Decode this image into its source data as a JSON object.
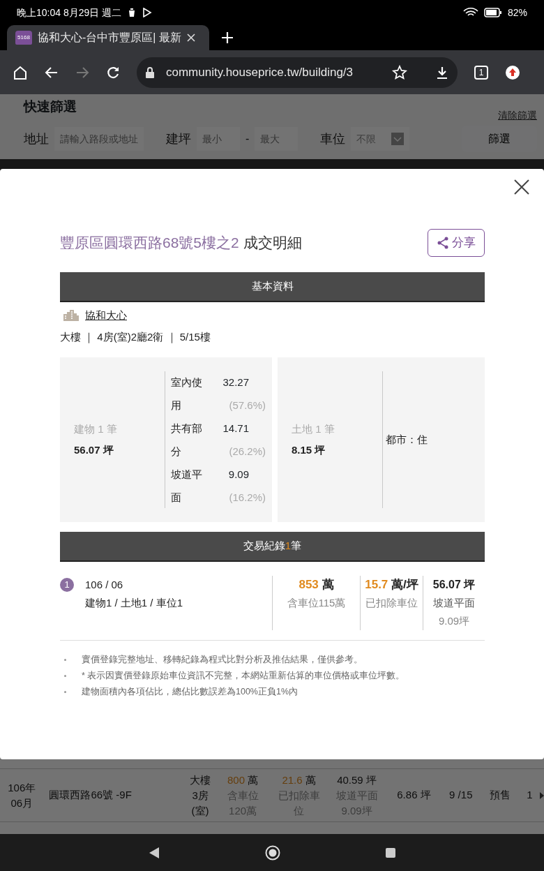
{
  "status_bar": {
    "time": "晚上10:04 8月29日 週二",
    "battery": "82%"
  },
  "browser": {
    "favicon_text": "5168",
    "tab_title": "協和大心-台中市豐原區| 最新",
    "url": "community.houseprice.tw/building/3",
    "forward_disabled": true,
    "tab_count": "1"
  },
  "filter": {
    "title": "快速篩選",
    "clear": "清除篩選",
    "address_label": "地址",
    "address_placeholder": "請輸入路段或地址",
    "area_label": "建坪",
    "area_min_placeholder": "最小",
    "dash": "-",
    "area_max_placeholder": "最大",
    "parking_label": "車位",
    "parking_value": "不限",
    "submit": "篩選"
  },
  "background_row": {
    "date_lines": [
      "106年",
      "06月"
    ],
    "address": "圓環西路66號 -9F",
    "type_lines": [
      "大樓",
      "3房",
      "(室)"
    ],
    "price": "800",
    "price_unit": "萬",
    "price_notes": [
      "含車位",
      "120萬"
    ],
    "unit_price": "21.6",
    "unit_price_unit": "萬",
    "unit_notes": [
      "已扣除車",
      "位"
    ],
    "area": "40.59 坪",
    "area_notes": [
      "坡道平面",
      "9.09坪"
    ],
    "land": "6.86 坪",
    "floor": "9 /15",
    "status": "預售",
    "count": "1"
  },
  "modal": {
    "title_address": "豐原區圓環西路68號5樓之2",
    "title_suffix": "成交明細",
    "share": "分享",
    "basic_header": "基本資料",
    "community": "協和大心",
    "info": "大樓 ｜ 4房(室)2廳2衛 ｜ 5/15樓",
    "building": {
      "label": "建物 1 筆",
      "area": "56.07 坪",
      "items": [
        {
          "name": "室內使用",
          "value": "32.27",
          "share": "(57.6%)"
        },
        {
          "name": "共有部分",
          "value": "14.71",
          "share": "(26.2%)"
        },
        {
          "name": "坡道平面",
          "value": "9.09",
          "share": "(16.2%)"
        }
      ]
    },
    "land": {
      "label": "土地 1 筆",
      "area": "8.15 坪",
      "zoning": "都市：住"
    },
    "records_header": {
      "before": "交易紀錄",
      "count": "1",
      "after": "筆"
    },
    "records": [
      {
        "index": "1",
        "date": "106 / 06",
        "parts": "建物1 / 土地1 / 車位1",
        "price": "853",
        "price_unit": "萬",
        "price_note": "含車位115萬",
        "unit_price": "15.7",
        "unit_price_unit": "萬/坪",
        "unit_note": "已扣除車位",
        "area": "56.07 坪",
        "area_note": "坡道平面",
        "area_note2": "9.09坪"
      }
    ],
    "notes": [
      "實價登錄完整地址、移轉紀錄為程式比對分析及推估結果，僅供參考。",
      "* 表示因實價登錄原始車位資訊不完整，本網站重新估算的車位價格或車位坪數。",
      "建物面積內各項佔比，總佔比數誤差為100%正負1%內"
    ]
  }
}
